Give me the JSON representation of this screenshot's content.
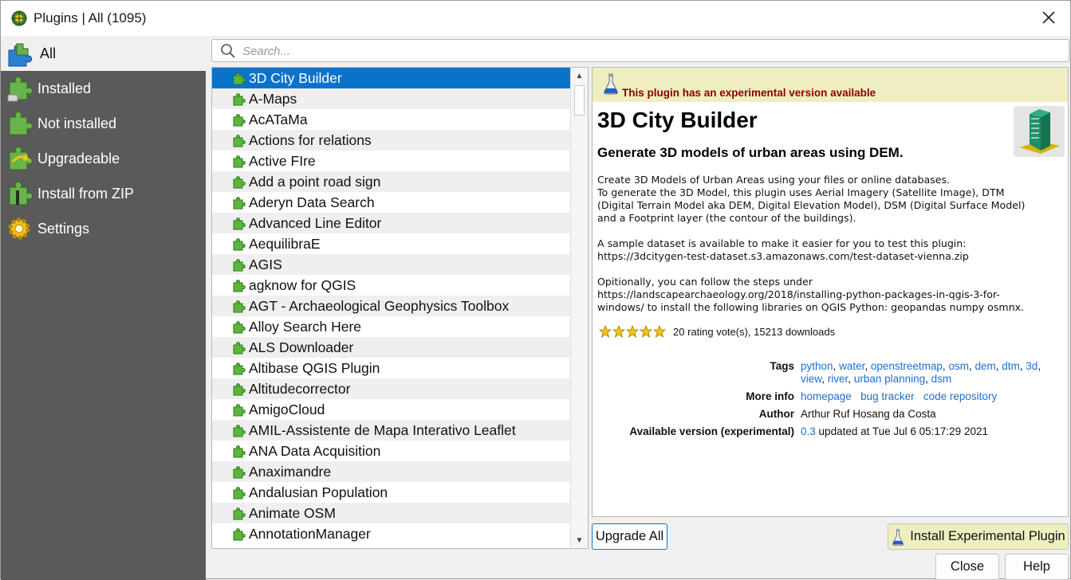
{
  "window": {
    "title": "Plugins | All (1095)"
  },
  "sidebar": {
    "items": [
      {
        "label": "All",
        "icon": "puzzle-all-icon"
      },
      {
        "label": "Installed",
        "icon": "puzzle-installed-icon"
      },
      {
        "label": "Not installed",
        "icon": "puzzle-not-installed-icon"
      },
      {
        "label": "Upgradeable",
        "icon": "puzzle-upgrade-icon"
      },
      {
        "label": "Install from ZIP",
        "icon": "puzzle-zip-icon"
      },
      {
        "label": "Settings",
        "icon": "gear-icon"
      }
    ]
  },
  "search": {
    "placeholder": "Search...",
    "value": ""
  },
  "plugin_list": {
    "items": [
      "3D City Builder",
      "A-Maps",
      "AcATaMa",
      "Actions for relations",
      "Active FIre",
      "Add a point road sign",
      "Aderyn Data Search",
      "Advanced Line Editor",
      "AequilibraE",
      "AGIS",
      "agknow for QGIS",
      "AGT - Archaeological Geophysics Toolbox",
      "Alloy Search Here",
      "ALS Downloader",
      "Altibase QGIS Plugin",
      "Altitudecorrector",
      "AmigoCloud",
      "AMIL-Assistente de Mapa Interativo Leaflet",
      "ANA Data Acquisition",
      "Anaximandre",
      "Andalusian Population",
      "Animate OSM",
      "AnnotationManager"
    ]
  },
  "detail": {
    "experimental_notice": "This plugin has an experimental version available",
    "name": "3D City Builder",
    "subtitle": "Generate 3D models of urban areas using DEM.",
    "description": [
      "Create 3D Models of Urban Areas using your files or online databases.\nTo generate the 3D Model, this plugin uses Aerial Imagery (Satellite Image), DTM\n(Digital Terrain Model aka DEM, Digital Elevation Model), DSM (Digital Surface Model)\nand a Footprint layer (the contour of the buildings).",
      "A sample dataset is available to make it easier for you to test this plugin:\nhttps://3dcitygen-test-dataset.s3.amazonaws.com/test-dataset-vienna.zip",
      "Opitionally, you can follow the steps under\nhttps://landscapearchaeology.org/2018/installing-python-packages-in-qgis-3-for-\nwindows/ to install the following libraries on QGIS Python: geopandas numpy osmnx."
    ],
    "rating": {
      "stars": 5,
      "text": "20 rating vote(s), 15213 downloads"
    },
    "tags_label": "Tags",
    "tags": [
      "python",
      "water",
      "openstreetmap",
      "osm",
      "dem",
      "dtm",
      "3d",
      "view",
      "river",
      "urban planning",
      "dsm"
    ],
    "more_info_label": "More info",
    "more_info_links": [
      "homepage",
      "bug tracker",
      "code repository"
    ],
    "author_label": "Author",
    "author": "Arthur Ruf Hosang da Costa",
    "version_label": "Available version (experimental)",
    "version": "0.3",
    "version_suffix": "updated at Tue Jul 6 05:17:29 2021"
  },
  "buttons": {
    "upgrade_all": "Upgrade All",
    "install_experimental": "Install Experimental Plugin",
    "close": "Close",
    "help": "Help"
  },
  "colors": {
    "selection": "#0a73c9",
    "sidebar": "#5a5a5a",
    "banner": "#efeec0",
    "link": "#1f6fd1",
    "notice": "#8b0000"
  }
}
